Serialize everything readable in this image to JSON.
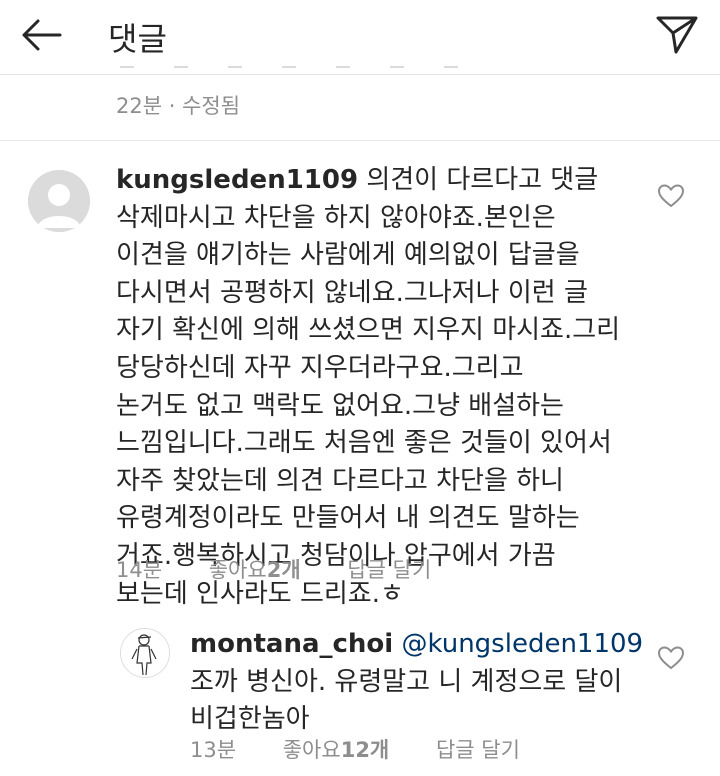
{
  "header": {
    "title": "댓글"
  },
  "previous_comment": {
    "meta": "22분 · 수정됨"
  },
  "comments": [
    {
      "username": "kungsleden1109",
      "text_lines": [
        " 의견이 다르다고 댓글",
        "삭제마시고 차단을 하지 않아야죠.본인은",
        "이견을 얘기하는 사람에게 예의없이 답글을",
        "다시면서 공평하지 않네요.그나저나 이런 글",
        "자기 확신에 의해 쓰셨으면 지우지 마시죠.그리",
        "당당하신데 자꾸 지우더라구요.그리고",
        "논거도 없고 맥락도 없어요.그냥 배설하는",
        "느낌입니다.그래도 처음엔 좋은 것들이 있어서",
        "자주 찾았는데 의견 다르다고 차단을 하니",
        "유령계정이라도 만들어서 내 의견도 말하는",
        "거죠.행복하시고 청담이나 압구에서 가끔",
        "보는데 인사라도 드리죠.ㅎ"
      ],
      "time": "14분",
      "likes_prefix": "좋아요 ",
      "likes_count": "2개",
      "reply_label": "답글 달기"
    },
    {
      "username": "montana_choi",
      "mention": "@kungsleden1109",
      "text_lines": [
        "조까 병신아. 유령말고 니 계정으로 달이",
        "비겁한놈아"
      ],
      "time": "13분",
      "likes_prefix": "좋아요 ",
      "likes_count": "12개",
      "reply_label": "답글 달기"
    }
  ],
  "icons": {
    "back": "arrow-left-icon",
    "send": "paper-plane-icon",
    "like": "heart-outline-icon",
    "avatar_default": "default-avatar-icon"
  },
  "colors": {
    "text": "#262626",
    "secondary": "#8e8e8e",
    "mention": "#003569"
  }
}
